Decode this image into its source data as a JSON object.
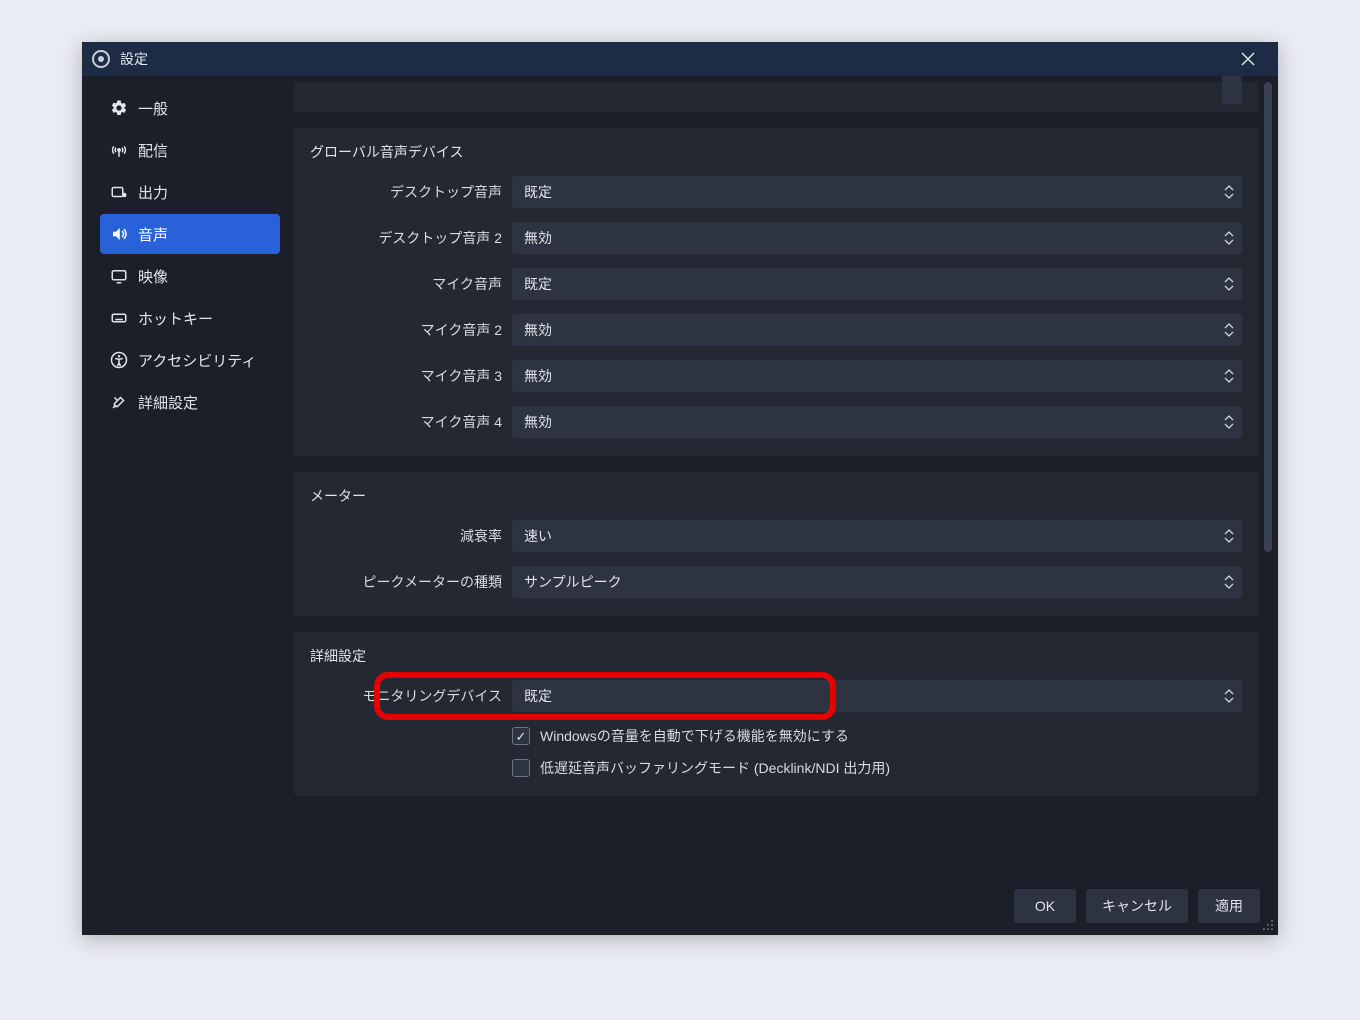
{
  "window": {
    "title": "設定"
  },
  "sidebar": {
    "items": [
      {
        "id": "general",
        "label": "一般"
      },
      {
        "id": "stream",
        "label": "配信"
      },
      {
        "id": "output",
        "label": "出力"
      },
      {
        "id": "audio",
        "label": "音声"
      },
      {
        "id": "video",
        "label": "映像"
      },
      {
        "id": "hotkeys",
        "label": "ホットキー"
      },
      {
        "id": "accessibility",
        "label": "アクセシビリティ"
      },
      {
        "id": "advanced",
        "label": "詳細設定"
      }
    ],
    "active_id": "audio"
  },
  "sections": {
    "global_audio": {
      "title": "グローバル音声デバイス",
      "rows": [
        {
          "label": "デスクトップ音声",
          "value": "既定"
        },
        {
          "label": "デスクトップ音声 2",
          "value": "無効"
        },
        {
          "label": "マイク音声",
          "value": "既定"
        },
        {
          "label": "マイク音声 2",
          "value": "無効"
        },
        {
          "label": "マイク音声 3",
          "value": "無効"
        },
        {
          "label": "マイク音声 4",
          "value": "無効"
        }
      ]
    },
    "meter": {
      "title": "メーター",
      "rows": [
        {
          "label": "減衰率",
          "value": "速い"
        },
        {
          "label": "ピークメーターの種類",
          "value": "サンプルピーク"
        }
      ]
    },
    "advanced": {
      "title": "詳細設定",
      "monitoring": {
        "label": "モニタリングデバイス",
        "value": "既定"
      },
      "checkbox1": {
        "label": "Windowsの音量を自動で下げる機能を無効にする",
        "checked": true
      },
      "checkbox2": {
        "label": "低遅延音声バッファリングモード (Decklink/NDI 出力用)",
        "checked": false
      }
    }
  },
  "footer": {
    "ok": "OK",
    "cancel": "キャンセル",
    "apply": "適用"
  }
}
